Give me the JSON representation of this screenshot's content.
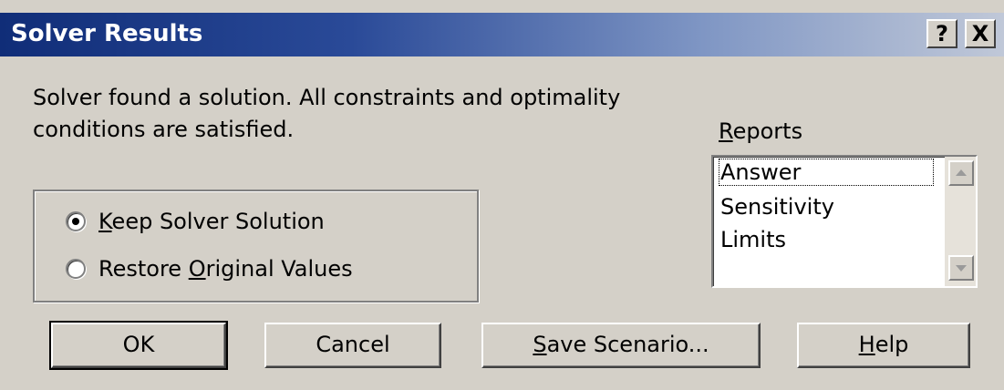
{
  "window": {
    "title": "Solver Results",
    "help_glyph": "?",
    "close_glyph": "X"
  },
  "message": {
    "line1": "Solver found a solution.  All constraints and optimality",
    "line2": "conditions are satisfied."
  },
  "options": {
    "keep": {
      "pre": "",
      "accel": "K",
      "post": "eep Solver Solution",
      "selected": true
    },
    "restore": {
      "pre": "Restore ",
      "accel": "O",
      "post": "riginal Values",
      "selected": false
    }
  },
  "reports": {
    "label_accel": "R",
    "label_rest": "eports",
    "items": [
      "Answer",
      "Sensitivity",
      "Limits"
    ]
  },
  "buttons": {
    "ok": "OK",
    "cancel": "Cancel",
    "save": {
      "accel": "S",
      "rest": "ave Scenario..."
    },
    "help": {
      "accel": "H",
      "rest": "elp"
    }
  },
  "icons": {
    "scroll_up": "scroll-up-arrow-icon",
    "scroll_down": "scroll-down-arrow-icon"
  }
}
